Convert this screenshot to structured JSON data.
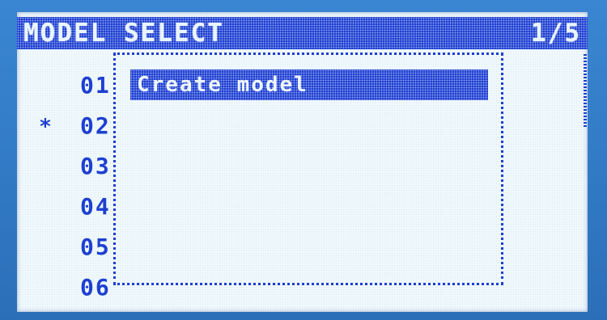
{
  "header": {
    "title": "MODEL SELECT",
    "value": "1/5"
  },
  "model_list": {
    "selected_marker": "*",
    "rows": [
      {
        "slot": "01",
        "marker": ""
      },
      {
        "slot": "02",
        "marker": "*"
      },
      {
        "slot": "03",
        "marker": ""
      },
      {
        "slot": "04",
        "marker": ""
      },
      {
        "slot": "05",
        "marker": ""
      },
      {
        "slot": "06",
        "marker": ""
      }
    ]
  },
  "popup": {
    "option_label": "Create model"
  },
  "colors": {
    "lcd_background": "#f2fbfd",
    "pixel_blue": "#1d3fd2",
    "bezel_blue": "#2f78c4"
  }
}
